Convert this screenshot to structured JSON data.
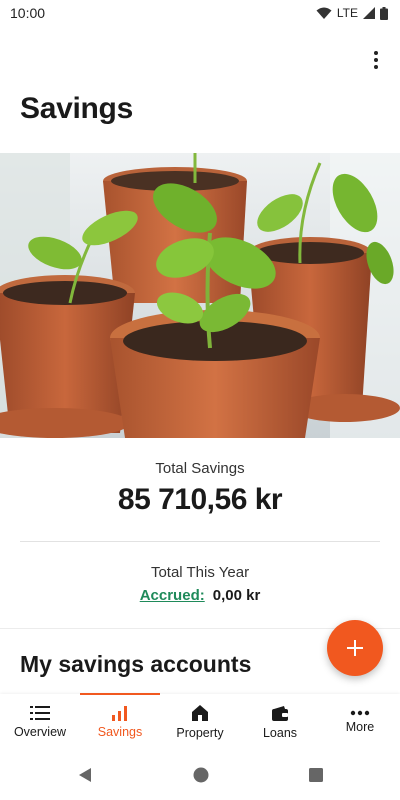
{
  "status_bar": {
    "time": "10:00",
    "network": "LTE"
  },
  "header": {
    "title": "Savings"
  },
  "summary": {
    "total_label": "Total Savings",
    "total_value": "85 710,56 kr",
    "year_label": "Total This Year",
    "accrued_label": "Accrued:",
    "accrued_value": "0,00 kr"
  },
  "accounts": {
    "title": "My savings accounts"
  },
  "nav": {
    "items": [
      {
        "label": "Overview",
        "icon": "list-icon"
      },
      {
        "label": "Savings",
        "icon": "bar-chart-icon",
        "active": true
      },
      {
        "label": "Property",
        "icon": "home-icon"
      },
      {
        "label": "Loans",
        "icon": "wallet-icon"
      },
      {
        "label": "More",
        "icon": "more-icon"
      }
    ]
  },
  "colors": {
    "accent": "#f1581f",
    "link": "#1f8a5a",
    "text": "#1a1a1a"
  }
}
